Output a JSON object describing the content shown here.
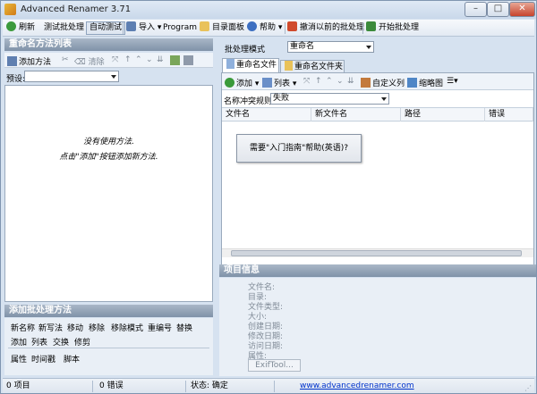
{
  "window": {
    "title": "Advanced Renamer 3.71",
    "min": "–",
    "max": "□",
    "close": "✕"
  },
  "toolbar": {
    "refresh": "刷新",
    "test_batch": "测试批处理",
    "auto_test": "自动测试",
    "import": "导入",
    "program": "Program",
    "dir_panel": "目录面板",
    "help": "帮助",
    "undo": "撤消以前的批处理",
    "start": "开始批处理"
  },
  "left": {
    "methods_header": "重命名方法列表",
    "add_method": "添加方法",
    "clear": "清除",
    "preset_label": "预设:",
    "preset_value": "",
    "empty_line1": "没有使用方法.",
    "empty_line2": "点击\"添加\"按钮添加新方法."
  },
  "add_batch": {
    "header": "添加批处理方法",
    "row1": [
      "新名称",
      "新写法",
      "移动",
      "移除",
      "移除模式",
      "重编号",
      "替换"
    ],
    "row2": [
      "添加",
      "列表",
      "交换",
      "修剪"
    ],
    "row3": [
      "属性",
      "时间戳",
      "脚本"
    ]
  },
  "right": {
    "batch_mode_label": "批处理模式",
    "batch_mode_value": "重命名",
    "tabs": [
      "重命名文件",
      "重命名文件夹"
    ],
    "add": "添加",
    "list": "列表",
    "custom_columns": "自定义列",
    "thumbnails": "缩略图",
    "conflict_label": "名称冲突规则:",
    "conflict_value": "失败",
    "columns": [
      "文件名",
      "新文件名",
      "路径",
      "错误"
    ],
    "help_button": "需要\"入门指南\"帮助(英语)?"
  },
  "item_info": {
    "header": "项目信息",
    "labels": [
      "文件名:",
      "目录:",
      "文件类型:",
      "大小:",
      "创建日期:",
      "修改日期:",
      "访问日期:",
      "属性:"
    ],
    "exif_button": "ExifTool..."
  },
  "status": {
    "items": "0 项目",
    "errors": "0 错误",
    "state": "状态: 确定",
    "url": "www.advancedrenamer.com"
  },
  "colors": {
    "accent_header": "#8a9cb1",
    "link": "#0033cc",
    "background": "#d6e2f0"
  }
}
